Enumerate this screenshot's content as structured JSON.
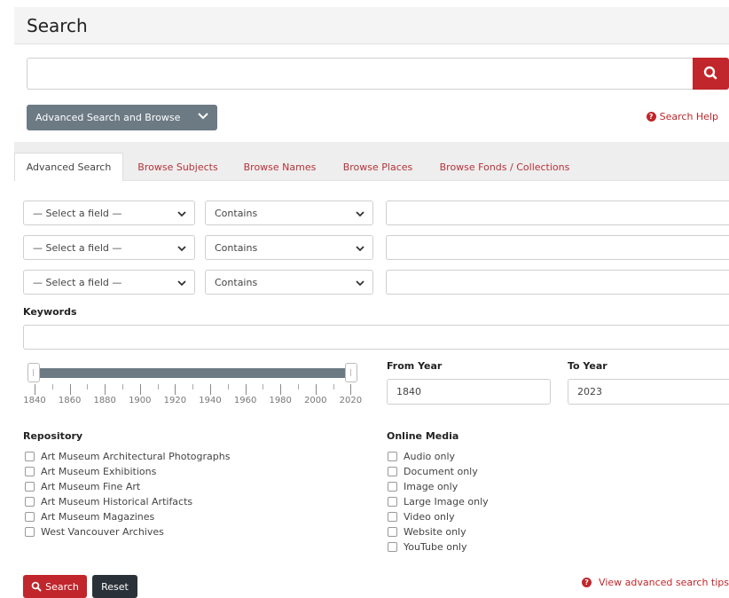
{
  "header": {
    "title": "Search"
  },
  "search": {
    "placeholder": "",
    "value": ""
  },
  "advanced_toggle": {
    "label": "Advanced Search and Browse"
  },
  "help": {
    "label": "Search Help"
  },
  "tabs": [
    {
      "label": "Advanced Search",
      "active": true
    },
    {
      "label": "Browse Subjects"
    },
    {
      "label": "Browse Names"
    },
    {
      "label": "Browse Places"
    },
    {
      "label": "Browse Fonds / Collections"
    }
  ],
  "field_rows": [
    {
      "field": "— Select a field —",
      "operator": "Contains",
      "value": ""
    },
    {
      "field": "— Select a field —",
      "operator": "Contains",
      "value": ""
    },
    {
      "field": "— Select a field —",
      "operator": "Contains",
      "value": ""
    }
  ],
  "keywords": {
    "label": "Keywords",
    "value": ""
  },
  "year_slider": {
    "min": 1840,
    "max": 2023,
    "tick_labels": [
      "1840",
      "1860",
      "1880",
      "1900",
      "1920",
      "1940",
      "1960",
      "1980",
      "2000",
      "2020"
    ]
  },
  "from_year": {
    "label": "From Year",
    "value": "1840"
  },
  "to_year": {
    "label": "To Year",
    "value": "2023"
  },
  "repository": {
    "label": "Repository",
    "items": [
      "Art Museum Architectural Photographs",
      "Art Museum Exhibitions",
      "Art Museum Fine Art",
      "Art Museum Historical Artifacts",
      "Art Museum Magazines",
      "West Vancouver Archives"
    ]
  },
  "online_media": {
    "label": "Online Media",
    "items": [
      "Audio only",
      "Document only",
      "Image only",
      "Large Image only",
      "Video only",
      "Website only",
      "YouTube only"
    ]
  },
  "actions": {
    "search_label": "Search",
    "reset_label": "Reset"
  },
  "tips": {
    "label": "View advanced search tips"
  },
  "colors": {
    "accent": "#c0262b",
    "slate": "#6c7a84",
    "dark": "#2b3138"
  }
}
